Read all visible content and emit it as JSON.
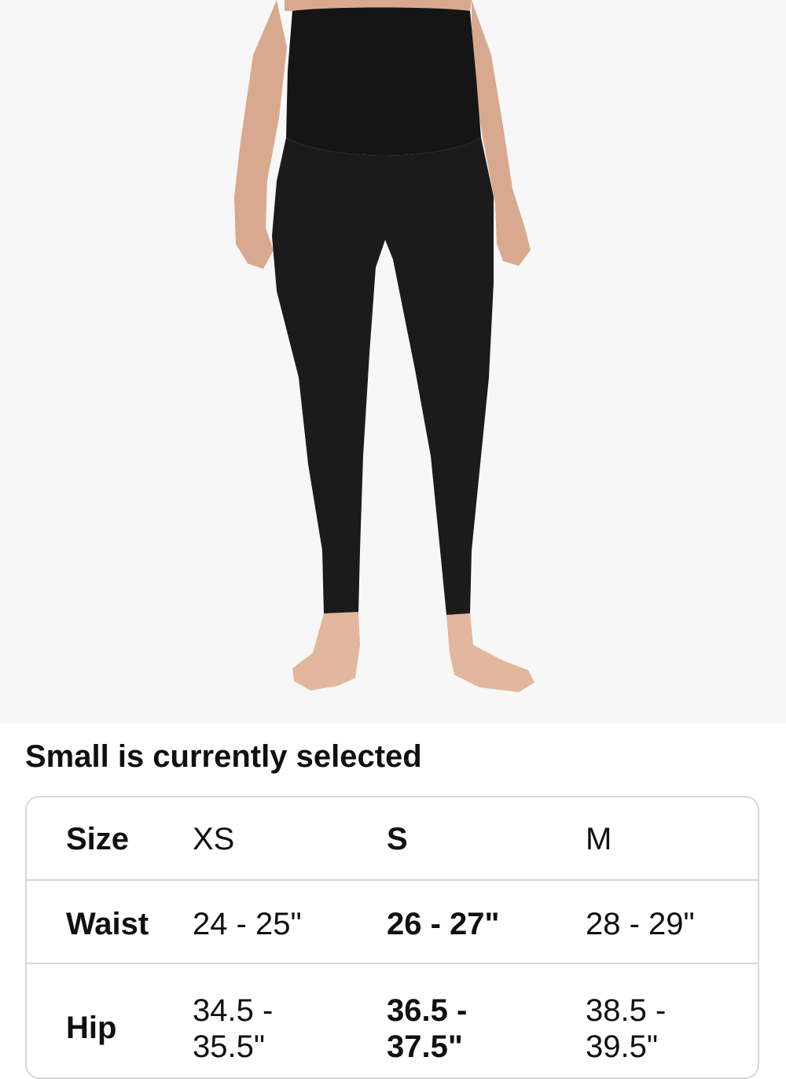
{
  "product_image": {
    "alt": "Black high-waisted maternity leggings"
  },
  "selection_text": "Small is currently selected",
  "size_table": {
    "header": {
      "label": "Size",
      "xs": "XS",
      "s": "S",
      "m": "M"
    },
    "waist": {
      "label": "Waist",
      "xs": "24 - 25\"",
      "s": "26 - 27\"",
      "m": "28 - 29\""
    },
    "hip": {
      "label": "Hip",
      "xs_line1": "34.5 -",
      "xs_line2": "35.5\"",
      "s_line1": "36.5 -",
      "s_line2": "37.5\"",
      "m_line1": "38.5 -",
      "m_line2": "39.5\""
    }
  },
  "colors": {
    "background": "#ffffff",
    "image_background": "#f7f7f7",
    "border": "#d5d9d9",
    "text": "#0f1111",
    "garment": "#1b1b1b",
    "skin": "#e8c2a8"
  }
}
